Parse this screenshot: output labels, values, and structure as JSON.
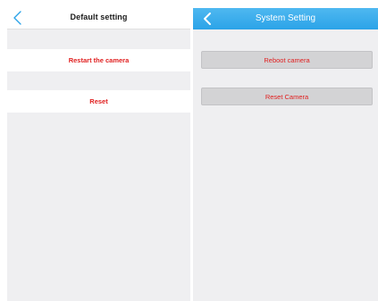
{
  "left_screen": {
    "header": {
      "title": "Default setting",
      "back_icon": "chevron-left-icon"
    },
    "items": [
      {
        "label": "Restart the camera"
      },
      {
        "label": "Reset"
      }
    ]
  },
  "right_screen": {
    "header": {
      "title": "System Setting",
      "back_icon": "chevron-left-icon"
    },
    "buttons": [
      {
        "label": "Reboot camera"
      },
      {
        "label": "Reset Camera"
      }
    ]
  },
  "colors": {
    "accent_red": "#e02020",
    "header_blue": "#2ba3e8",
    "panel_background": "#efeff1",
    "button_gray": "#d3d3d5"
  }
}
